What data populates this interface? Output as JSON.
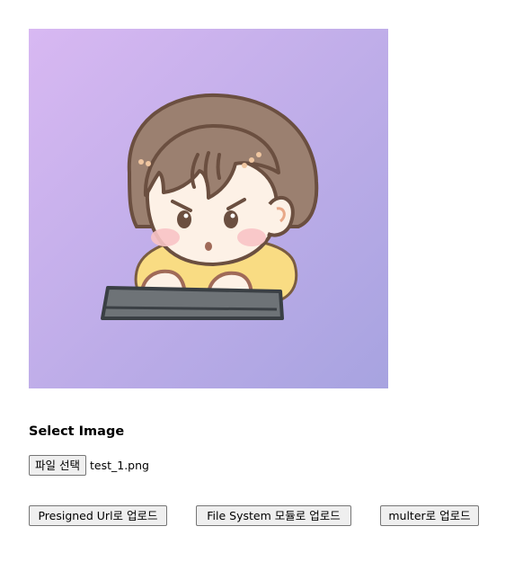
{
  "preview": {
    "image_name": "cartoon-boy-typing-on-keyboard",
    "gradient_start": "#d8b8f2",
    "gradient_end": "#a7a3e0"
  },
  "form": {
    "heading": "Select Image",
    "choose_file_label": "파일 선택",
    "file_name": "test_1.png"
  },
  "upload_buttons": {
    "presigned": "Presigned Url로 업로드",
    "file_system": "File System 모듈로 업로드",
    "multer": "multer로 업로드"
  }
}
